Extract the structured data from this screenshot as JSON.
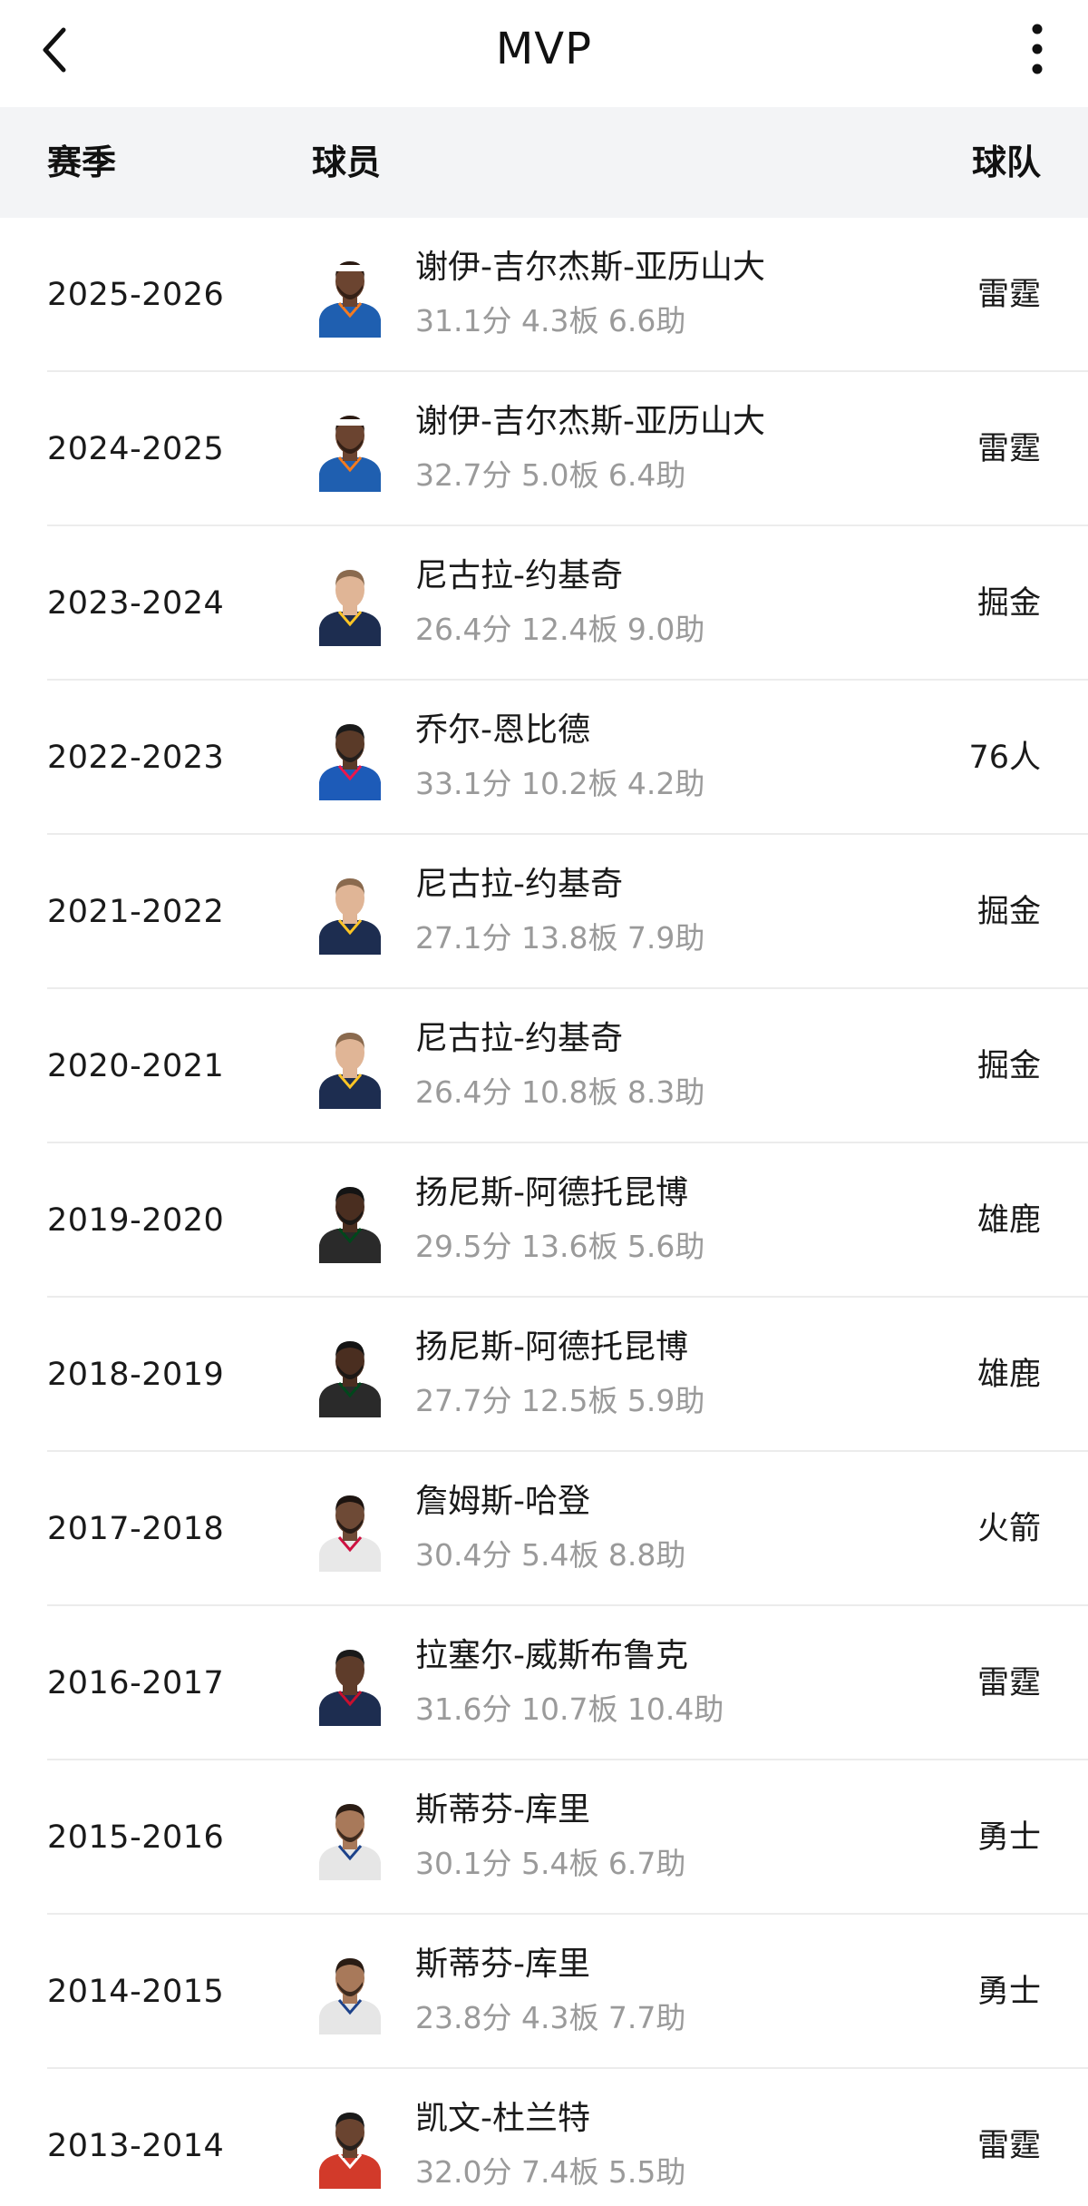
{
  "header": {
    "title": "MVP"
  },
  "icons": {
    "back": "chevron-left-icon",
    "more": "more-vertical-icon"
  },
  "table": {
    "columns": {
      "season": "赛季",
      "player": "球员",
      "team": "球队"
    },
    "rows": [
      {
        "season": "2025-2026",
        "player": "谢伊-吉尔杰斯-亚历山大",
        "stats": "31.1分 4.3板 6.6助",
        "team": "雷霆",
        "jersey": "#1f5fb0",
        "trim": "#f47b20",
        "skin": "#6b4430",
        "hair": "#2a1a12",
        "beard": true,
        "band": true
      },
      {
        "season": "2024-2025",
        "player": "谢伊-吉尔杰斯-亚历山大",
        "stats": "32.7分 5.0板 6.4助",
        "team": "雷霆",
        "jersey": "#1f5fb0",
        "trim": "#f47b20",
        "skin": "#6b4430",
        "hair": "#2a1a12",
        "beard": true,
        "band": true
      },
      {
        "season": "2023-2024",
        "player": "尼古拉-约基奇",
        "stats": "26.4分 12.4板 9.0助",
        "team": "掘金",
        "jersey": "#1d2d50",
        "trim": "#fec524",
        "skin": "#e0b596",
        "hair": "#8a6a4e",
        "beard": false,
        "band": false
      },
      {
        "season": "2022-2023",
        "player": "乔尔-恩比德",
        "stats": "33.1分 10.2板 4.2助",
        "team": "76人",
        "jersey": "#1d5bb8",
        "trim": "#ed174c",
        "skin": "#5a3a28",
        "hair": "#1a1a1a",
        "beard": true,
        "band": false
      },
      {
        "season": "2021-2022",
        "player": "尼古拉-约基奇",
        "stats": "27.1分 13.8板 7.9助",
        "team": "掘金",
        "jersey": "#1d2d50",
        "trim": "#fec524",
        "skin": "#e0b596",
        "hair": "#8a6a4e",
        "beard": false,
        "band": false
      },
      {
        "season": "2020-2021",
        "player": "尼古拉-约基奇",
        "stats": "26.4分 10.8板 8.3助",
        "team": "掘金",
        "jersey": "#1d2d50",
        "trim": "#fec524",
        "skin": "#e0b596",
        "hair": "#8a6a4e",
        "beard": false,
        "band": false
      },
      {
        "season": "2019-2020",
        "player": "扬尼斯-阿德托昆博",
        "stats": "29.5分 13.6板 5.6助",
        "team": "雄鹿",
        "jersey": "#2a2a2a",
        "trim": "#00471b",
        "skin": "#4a2e20",
        "hair": "#141414",
        "beard": true,
        "band": false
      },
      {
        "season": "2018-2019",
        "player": "扬尼斯-阿德托昆博",
        "stats": "27.7分 12.5板 5.9助",
        "team": "雄鹿",
        "jersey": "#2a2a2a",
        "trim": "#00471b",
        "skin": "#4a2e20",
        "hair": "#141414",
        "beard": true,
        "band": false
      },
      {
        "season": "2017-2018",
        "player": "詹姆斯-哈登",
        "stats": "30.4分 5.4板 8.8助",
        "team": "火箭",
        "jersey": "#e8e8e8",
        "trim": "#ce1141",
        "skin": "#6e4a36",
        "hair": "#1c1410",
        "beard": true,
        "band": false
      },
      {
        "season": "2016-2017",
        "player": "拉塞尔-威斯布鲁克",
        "stats": "31.6分 10.7板 10.4助",
        "team": "雷霆",
        "jersey": "#1d2d50",
        "trim": "#c8102e",
        "skin": "#5e3c2a",
        "hair": "#1a1a1a",
        "beard": false,
        "band": false
      },
      {
        "season": "2015-2016",
        "player": "斯蒂芬-库里",
        "stats": "30.1分 5.4板 6.7助",
        "team": "勇士",
        "jersey": "#e6e6e6",
        "trim": "#1d428a",
        "skin": "#a8795a",
        "hair": "#2a1c14",
        "beard": true,
        "band": false
      },
      {
        "season": "2014-2015",
        "player": "斯蒂芬-库里",
        "stats": "23.8分 4.3板 7.7助",
        "team": "勇士",
        "jersey": "#e6e6e6",
        "trim": "#1d428a",
        "skin": "#a8795a",
        "hair": "#2a1c14",
        "beard": true,
        "band": false
      },
      {
        "season": "2013-2014",
        "player": "凯文-杜兰特",
        "stats": "32.0分 7.4板 5.5助",
        "team": "雷霆",
        "jersey": "#d23a2a",
        "trim": "#ffffff",
        "skin": "#6a4430",
        "hair": "#1a1a1a",
        "beard": true,
        "band": false
      }
    ]
  }
}
